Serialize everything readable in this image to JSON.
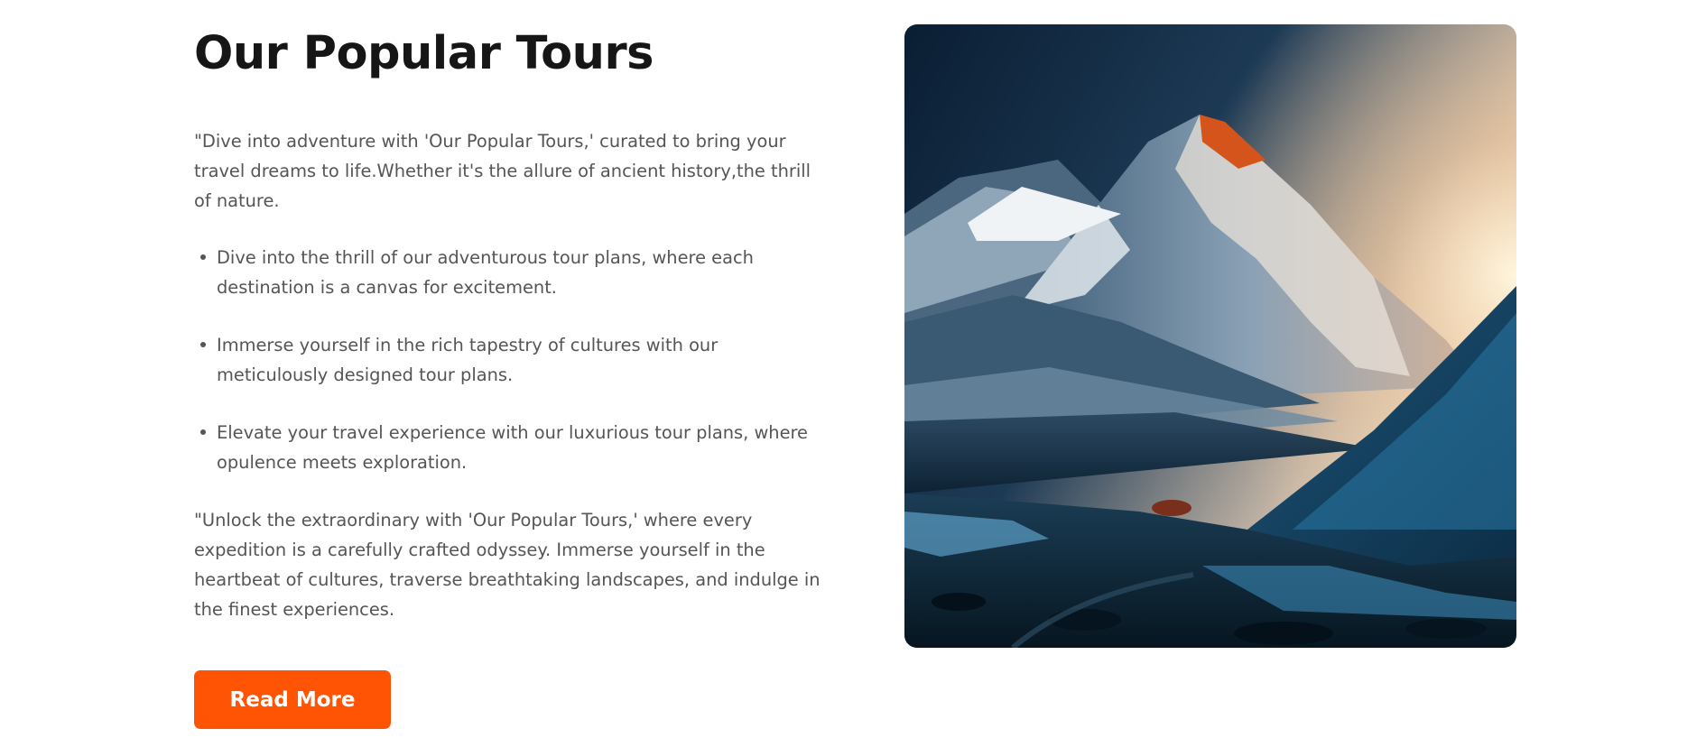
{
  "section": {
    "title": "Our Popular Tours",
    "intro": "\"Dive into adventure with 'Our Popular Tours,' curated to bring your travel dreams to life.Whether it's the allure of ancient history,the thrill of nature.",
    "features": [
      "Dive into the thrill of our adventurous tour plans, where each destination is a canvas for excitement.",
      "Immerse yourself in the rich tapestry of cultures with our meticulously designed tour plans.",
      "Elevate your travel experience with our luxurious tour plans, where opulence meets exploration."
    ],
    "outro": "\"Unlock the extraordinary with 'Our Popular Tours,' where every expedition is a carefully crafted odyssey. Immerse yourself in the heartbeat of cultures, traverse breathtaking landscapes, and indulge in the finest experiences.",
    "button_label": "Read More"
  },
  "colors": {
    "accent": "#ff5403",
    "heading": "#161616",
    "body_text": "#555555"
  },
  "image": {
    "subject": "snowy mountain peak at sunset"
  }
}
